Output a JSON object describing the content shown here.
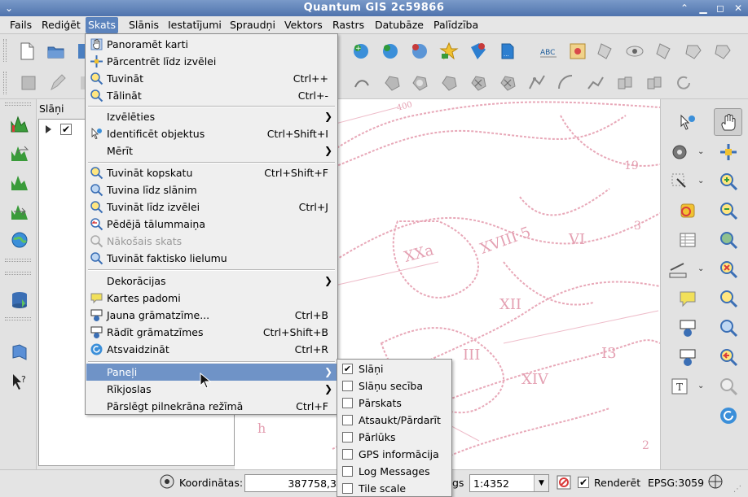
{
  "window": {
    "title": "Quantum GIS 2c59866"
  },
  "menubar": {
    "items": [
      "Fails",
      "Rediģēt",
      "Skats",
      "Slānis",
      "Iestatījumi",
      "Spraudņi",
      "Vektors",
      "Rastrs",
      "Datubāze",
      "Palīdzība"
    ],
    "active": "Skats"
  },
  "layers_panel": {
    "title": "Slāņi"
  },
  "view_menu": {
    "items": [
      {
        "label": "Panoramēt karti",
        "shortcut": "",
        "icon": "pan-hand-icon"
      },
      {
        "label": "Pārcentrēt līdz izvēlei",
        "shortcut": "",
        "icon": "pan-to-selection-icon"
      },
      {
        "label": "Tuvināt",
        "shortcut": "Ctrl++",
        "icon": "zoom-in-icon"
      },
      {
        "label": "Tālināt",
        "shortcut": "Ctrl+-",
        "icon": "zoom-out-icon"
      },
      {
        "label": "Izvēlēties",
        "shortcut": "",
        "icon": "",
        "submenu": true
      },
      {
        "label": "Identificēt objektus",
        "shortcut": "Ctrl+Shift+I",
        "icon": "identify-icon"
      },
      {
        "label": "Mērīt",
        "shortcut": "",
        "icon": "",
        "submenu": true
      },
      {
        "label": "Tuvināt kopskatu",
        "shortcut": "Ctrl+Shift+F",
        "icon": "zoom-full-icon"
      },
      {
        "label": "Tuvina līdz slānim",
        "shortcut": "",
        "icon": "zoom-layer-icon"
      },
      {
        "label": "Tuvināt līdz izvēlei",
        "shortcut": "Ctrl+J",
        "icon": "zoom-selection-icon"
      },
      {
        "label": "Pēdējā tālummaiņa",
        "shortcut": "",
        "icon": "zoom-last-icon"
      },
      {
        "label": "Nākošais skats",
        "shortcut": "",
        "icon": "zoom-next-icon",
        "disabled": true
      },
      {
        "label": "Tuvināt faktisko lielumu",
        "shortcut": "",
        "icon": "zoom-actual-icon"
      },
      {
        "label": "Dekorācijas",
        "shortcut": "",
        "icon": "",
        "submenu": true
      },
      {
        "label": "Kartes padomi",
        "shortcut": "",
        "icon": "map-tips-icon"
      },
      {
        "label": "Jauna grāmatzīme...",
        "shortcut": "Ctrl+B",
        "icon": "new-bookmark-icon"
      },
      {
        "label": "Rādīt grāmatzīmes",
        "shortcut": "Ctrl+Shift+B",
        "icon": "show-bookmarks-icon"
      },
      {
        "label": "Atsvaidzināt",
        "shortcut": "Ctrl+R",
        "icon": "refresh-icon"
      },
      {
        "label": "Paneļi",
        "shortcut": "",
        "icon": "",
        "submenu": true,
        "highlighted": true
      },
      {
        "label": "Rīkjoslas",
        "shortcut": "",
        "icon": "",
        "submenu": true
      },
      {
        "label": "Pārslēgt pilnekrāna režīmā",
        "shortcut": "Ctrl+F",
        "icon": ""
      }
    ]
  },
  "panels_submenu": {
    "items": [
      {
        "label": "Slāņi",
        "checked": true
      },
      {
        "label": "Slāņu secība",
        "checked": false
      },
      {
        "label": "Pārskats",
        "checked": false
      },
      {
        "label": "Atsaukt/Pārdarīt",
        "checked": false
      },
      {
        "label": "Pārlūks",
        "checked": false
      },
      {
        "label": "GPS informācija",
        "checked": false
      },
      {
        "label": "Log Messages",
        "checked": false
      },
      {
        "label": "Tile scale",
        "checked": false
      }
    ]
  },
  "statusbar": {
    "coord_label": "Koordinātas:",
    "coord_value": "387758,3",
    "scale_label_partial": "gs",
    "scale_value": "1:4352",
    "render_label": "Renderēt",
    "render_checked": true,
    "crs": "EPSG:3059"
  },
  "map_labels": [
    "400",
    "XVIII 5",
    "XXa",
    "VI",
    "XII",
    "XIV",
    "III",
    "19",
    "3",
    "I3",
    "2",
    "h"
  ],
  "colors": {
    "menu_highlight": "#6f93c7",
    "map_lines": "#e8a8b8"
  }
}
